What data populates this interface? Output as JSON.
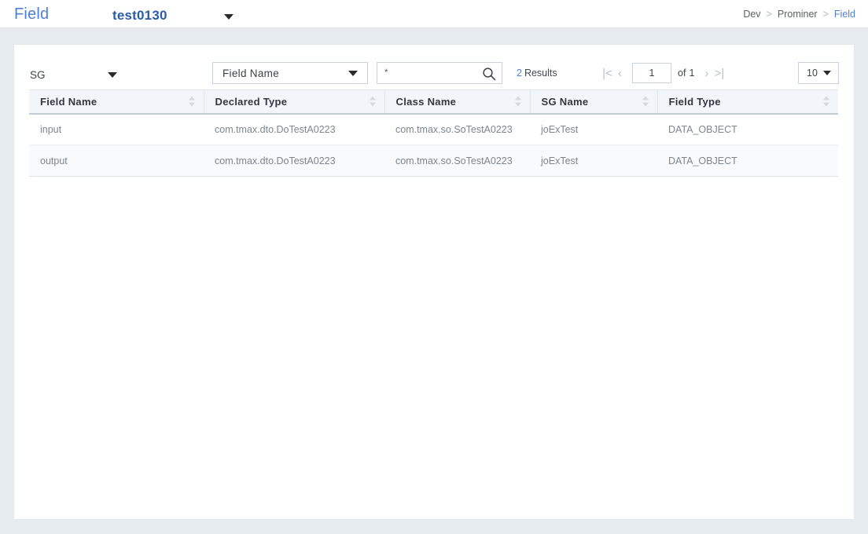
{
  "header": {
    "title": "Field",
    "project": {
      "name": "test0130",
      "caret_icon": "caret-down-icon"
    },
    "breadcrumb": [
      {
        "label": "Dev",
        "current": false
      },
      {
        "label": "Prominer",
        "current": false
      },
      {
        "label": "Field",
        "current": true
      }
    ],
    "breadcrumb_separator": ">"
  },
  "toolbar": {
    "sg_select": {
      "value": "SG",
      "caret_icon": "caret-down-icon"
    },
    "field_select": {
      "value": "Field  Name",
      "caret_icon": "caret-down-icon"
    },
    "search": {
      "value": "*",
      "placeholder": "",
      "icon": "search-icon"
    },
    "results": {
      "count": "2",
      "label": "Results"
    },
    "pagination": {
      "first_label": "|<",
      "prev_label": "‹",
      "page_value": "1",
      "of_label": "of",
      "total_pages": "1",
      "next_label": "›",
      "last_label": ">|"
    },
    "page_size": {
      "value": "10",
      "caret_icon": "caret-down-icon"
    }
  },
  "table": {
    "columns": [
      {
        "label": "Field  Name",
        "sortable": true
      },
      {
        "label": "Declared  Type",
        "sortable": true
      },
      {
        "label": "Class  Name",
        "sortable": true
      },
      {
        "label": "SG  Name",
        "sortable": true
      },
      {
        "label": "Field  Type",
        "sortable": true
      }
    ],
    "rows": [
      {
        "field_name": "input",
        "declared_type": "com.tmax.dto.DoTestA0223",
        "class_name": "com.tmax.so.SoTestA0223",
        "sg_name": "joExTest",
        "field_type": "DATA_OBJECT"
      },
      {
        "field_name": "output",
        "declared_type": "com.tmax.dto.DoTestA0223",
        "class_name": "com.tmax.so.SoTestA0223",
        "sg_name": "joExTest",
        "field_type": "DATA_OBJECT"
      }
    ]
  },
  "colors": {
    "accent": "#4f7fd0",
    "project_name": "#2a5ca8",
    "page_background": "#e6ebf0",
    "card_background": "#ffffff",
    "table_header_background": "#f2f6fa",
    "row_alt_background": "#f8fafb"
  }
}
